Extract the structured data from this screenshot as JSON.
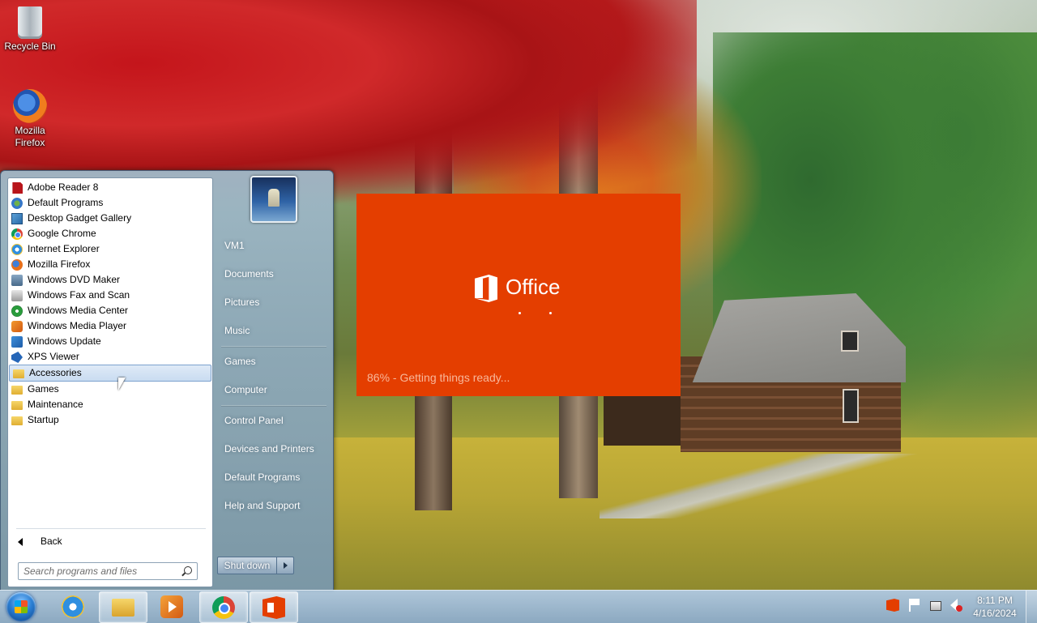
{
  "desktop": {
    "icons": [
      {
        "label": "Recycle Bin",
        "icon": "recycle-bin-icon"
      },
      {
        "label": "Mozilla Firefox",
        "icon": "firefox-icon"
      }
    ]
  },
  "start_menu": {
    "programs": [
      {
        "label": "Adobe Reader 8",
        "icon": "adobe-reader-icon"
      },
      {
        "label": "Default Programs",
        "icon": "default-programs-icon"
      },
      {
        "label": "Desktop Gadget Gallery",
        "icon": "gadget-gallery-icon"
      },
      {
        "label": "Google Chrome",
        "icon": "chrome-icon"
      },
      {
        "label": "Internet Explorer",
        "icon": "internet-explorer-icon"
      },
      {
        "label": "Mozilla Firefox",
        "icon": "firefox-icon"
      },
      {
        "label": "Windows DVD Maker",
        "icon": "dvd-maker-icon"
      },
      {
        "label": "Windows Fax and Scan",
        "icon": "fax-scan-icon"
      },
      {
        "label": "Windows Media Center",
        "icon": "media-center-icon"
      },
      {
        "label": "Windows Media Player",
        "icon": "media-player-icon"
      },
      {
        "label": "Windows Update",
        "icon": "windows-update-icon"
      },
      {
        "label": "XPS Viewer",
        "icon": "xps-viewer-icon"
      },
      {
        "label": "Accessories",
        "icon": "folder-icon",
        "highlighted": true
      },
      {
        "label": "Games",
        "icon": "folder-icon"
      },
      {
        "label": "Maintenance",
        "icon": "folder-icon"
      },
      {
        "label": "Startup",
        "icon": "folder-icon"
      }
    ],
    "back_label": "Back",
    "search_placeholder": "Search programs and files",
    "places": [
      {
        "label": "VM1"
      },
      {
        "label": "Documents"
      },
      {
        "label": "Pictures"
      },
      {
        "label": "Music"
      },
      {
        "label": "Games"
      },
      {
        "label": "Computer"
      },
      {
        "label": "Control Panel"
      },
      {
        "label": "Devices and Printers"
      },
      {
        "label": "Default Programs"
      },
      {
        "label": "Help and Support"
      }
    ],
    "shutdown_label": "Shut down"
  },
  "office_splash": {
    "product": "Office",
    "progress_text": "86% - Getting things ready...",
    "progress_percent": 86,
    "background_color": "#e43e00"
  },
  "taskbar": {
    "buttons": [
      {
        "name": "internet-explorer",
        "icon": "internet-explorer-icon",
        "active": false
      },
      {
        "name": "windows-explorer",
        "icon": "folder-icon",
        "active": true
      },
      {
        "name": "windows-media-player",
        "icon": "media-player-icon",
        "active": false
      },
      {
        "name": "google-chrome",
        "icon": "chrome-icon",
        "active": true
      },
      {
        "name": "office",
        "icon": "office-icon",
        "active": true
      }
    ],
    "tray_icons": [
      "office-icon",
      "action-center-flag-icon",
      "network-icon",
      "volume-muted-icon"
    ],
    "clock": {
      "time": "8:11 PM",
      "date": "4/16/2024"
    }
  }
}
